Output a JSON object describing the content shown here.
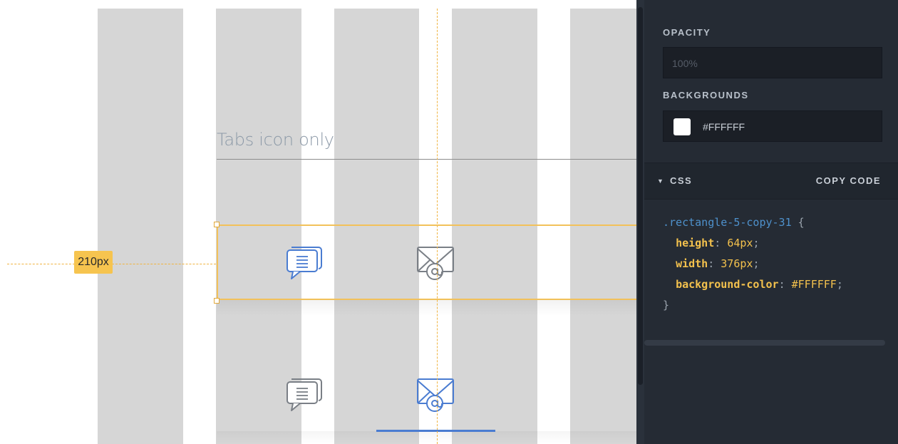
{
  "canvas": {
    "section_title": "Tabs icon only",
    "distance_label": "210px",
    "tab_icons": {
      "row1": [
        "chat-bubble-icon",
        "mail-at-icon"
      ],
      "row2": [
        "chat-bubble-icon",
        "mail-at-icon"
      ]
    },
    "colors": {
      "selection": "#f2c15a",
      "active_tab": "#4a7cd1",
      "inactive_icon": "#7a7f86"
    }
  },
  "inspector": {
    "opacity_label": "OPACITY",
    "opacity_placeholder": "100%",
    "backgrounds_label": "BACKGROUNDS",
    "background_swatch": "#FFFFFF",
    "background_value": "#FFFFFF",
    "css_section_label": "CSS",
    "copy_code_label": "COPY CODE",
    "code": {
      "selector": ".rectangle-5-copy-31",
      "open_brace": " {",
      "close_brace": "}",
      "declarations": [
        {
          "property": "height",
          "value": "64px"
        },
        {
          "property": "width",
          "value": "376px"
        },
        {
          "property": "background-color",
          "value": "#FFFFFF"
        }
      ]
    }
  }
}
